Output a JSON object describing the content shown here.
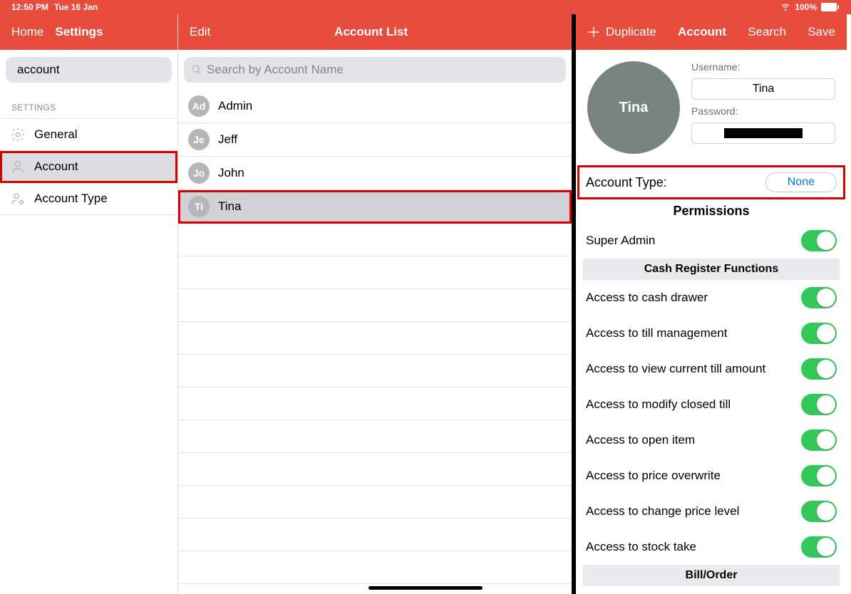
{
  "status": {
    "time": "12:50 PM",
    "date": "Tue 16 Jan",
    "battery": "100%"
  },
  "sidebar": {
    "home": "Home",
    "title": "Settings",
    "search_value": "account",
    "section": "SETTINGS",
    "items": [
      {
        "label": "General"
      },
      {
        "label": "Account"
      },
      {
        "label": "Account Type"
      }
    ]
  },
  "middle": {
    "edit": "Edit",
    "title": "Account List",
    "search_placeholder": "Search by Account Name",
    "accounts": [
      {
        "initials": "Ad",
        "name": "Admin"
      },
      {
        "initials": "Je",
        "name": "Jeff"
      },
      {
        "initials": "Jo",
        "name": "John"
      },
      {
        "initials": "Ti",
        "name": "Tina"
      }
    ]
  },
  "right": {
    "duplicate": "Duplicate",
    "account": "Account",
    "search": "Search",
    "save": "Save",
    "profile": {
      "avatar_name": "Tina",
      "username_label": "Username:",
      "username": "Tina",
      "password_label": "Password:"
    },
    "account_type": {
      "label": "Account Type:",
      "value": "None"
    },
    "permissions_header": "Permissions",
    "super_admin": "Super Admin",
    "section_cash": "Cash Register Functions",
    "perms": [
      "Access to cash drawer",
      "Access to till management",
      "Access to view current till amount",
      "Access to modify closed till",
      "Access to open item",
      "Access to price overwrite",
      "Access to change price level",
      "Access to stock take"
    ],
    "section_bill": "Bill/Order"
  }
}
